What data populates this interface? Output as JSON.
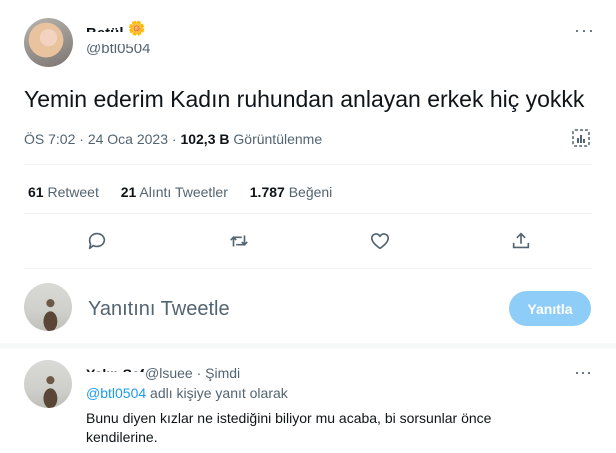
{
  "tweet": {
    "author_name": "Betül",
    "author_emoji": "🌼",
    "author_handle": "@btl0504",
    "text": "Yemin ederim Kadın ruhundan anlayan erkek hiç yokkk",
    "time": "ÖS 7:02",
    "date": "24 Oca 2023",
    "views": "102,3 B",
    "views_label": "Görüntülenme",
    "separator": "·"
  },
  "stats": {
    "retweets": "61",
    "retweets_label": "Retweet",
    "quotes": "21",
    "quotes_label": "Alıntı Tweetler",
    "likes": "1.787",
    "likes_label": "Beğeni"
  },
  "compose": {
    "placeholder": "Yanıtını Tweetle",
    "button_label": "Yanıtla"
  },
  "reply": {
    "author_name": "Yalın Şef",
    "author_handle": "@lsuee",
    "time": "Şimdi",
    "replying_mention": "@btl0504",
    "replying_suffix": "adlı kişiye yanıt olarak",
    "text": "Bunu diyen kızlar ne istediğini biliyor mu acaba, bi sorsunlar önce kendilerine."
  },
  "icons": {
    "more": "more-horizontal-icon",
    "analytics": "analytics-icon",
    "reply": "reply-icon",
    "retweet": "retweet-icon",
    "like": "heart-icon",
    "share": "share-icon"
  },
  "colors": {
    "accent": "#1d9bf0",
    "button_disabled": "#8ecdf8",
    "muted_text": "#536471"
  }
}
